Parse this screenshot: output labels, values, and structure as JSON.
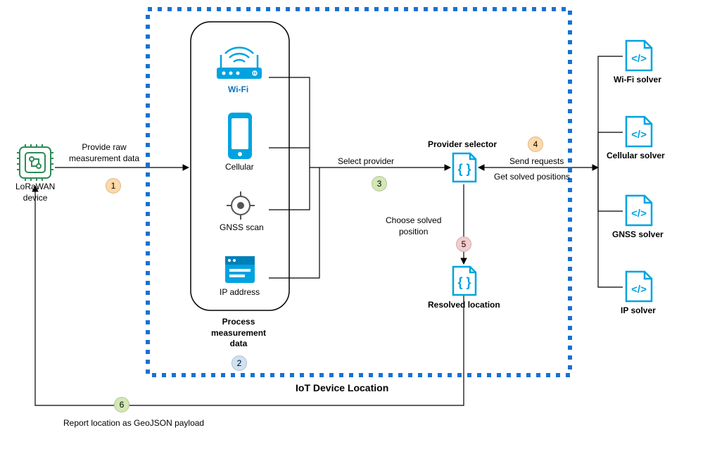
{
  "title": "IoT Device Location",
  "device": {
    "label": "LoRaWAN\ndevice"
  },
  "measurements": {
    "wifi": "Wi-Fi",
    "cellular": "Cellular",
    "gnss": "GNSS scan",
    "ip": "IP address",
    "group_label": "Process\nmeasurement\ndata"
  },
  "provider_selector": {
    "label": "Provider selector"
  },
  "resolved": {
    "label": "Resolved location"
  },
  "solvers": {
    "wifi": "Wi-Fi solver",
    "cellular": "Cellular solver",
    "gnss": "GNSS solver",
    "ip": "IP solver"
  },
  "edges": {
    "raw": "Provide raw\nmeasurement data",
    "select": "Select provider",
    "choose": "Choose solved\nposition",
    "send": "Send requests",
    "get": "Get solved positions",
    "report": "Report location as GeoJSON payload"
  },
  "steps": {
    "s1": "1",
    "s2": "2",
    "s3": "3",
    "s4": "4",
    "s5": "5",
    "s6": "6"
  }
}
